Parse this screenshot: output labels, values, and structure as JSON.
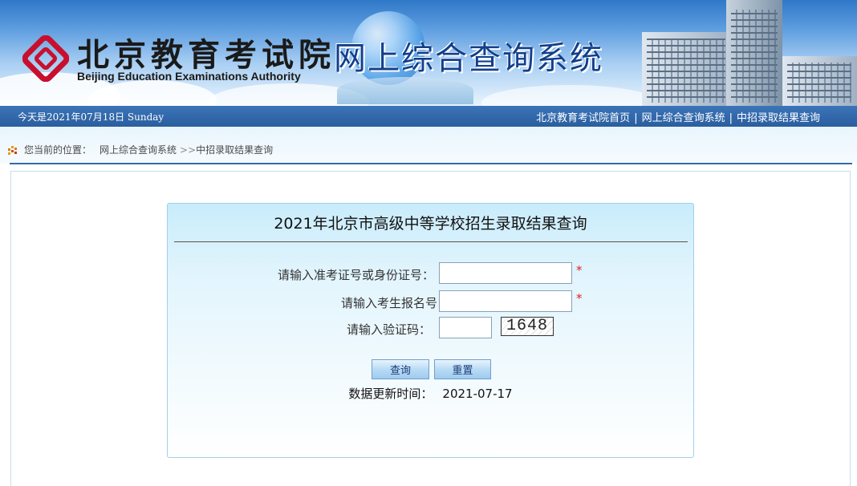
{
  "header": {
    "org_name_cn": "北京教育考试院",
    "org_name_en": "Beijing Education Examinations Authority",
    "system_title": "网上综合查询系统"
  },
  "navbar": {
    "today_text": "今天是2021年07月18日  Sunday",
    "links": [
      "北京教育考试院首页",
      "网上综合查询系统",
      "中招录取结果查询"
    ],
    "separator": "|"
  },
  "breadcrumb": {
    "prefix": "您当前的位置：",
    "root": "网上综合查询系统",
    "arrow": ">>",
    "current": "中招录取结果查询"
  },
  "form": {
    "title": "2021年北京市高级中等学校招生录取结果查询",
    "fields": [
      {
        "label": "请输入准考证号或身份证号：",
        "value": "",
        "required": true
      },
      {
        "label": "请输入考生报名号",
        "value": "",
        "required": true
      },
      {
        "label": "请输入验证码：",
        "value": "",
        "required": false
      }
    ],
    "required_mark": "*",
    "captcha_text": "1648",
    "query_button": "查询",
    "reset_button": "重置",
    "update_label": "数据更新时间：",
    "update_value": "2021-07-17"
  },
  "colors": {
    "nav_bar": "#2f6aaf",
    "title_blue": "#123f8c",
    "required_red": "#e02020",
    "panel_border": "#9fd0ec"
  }
}
